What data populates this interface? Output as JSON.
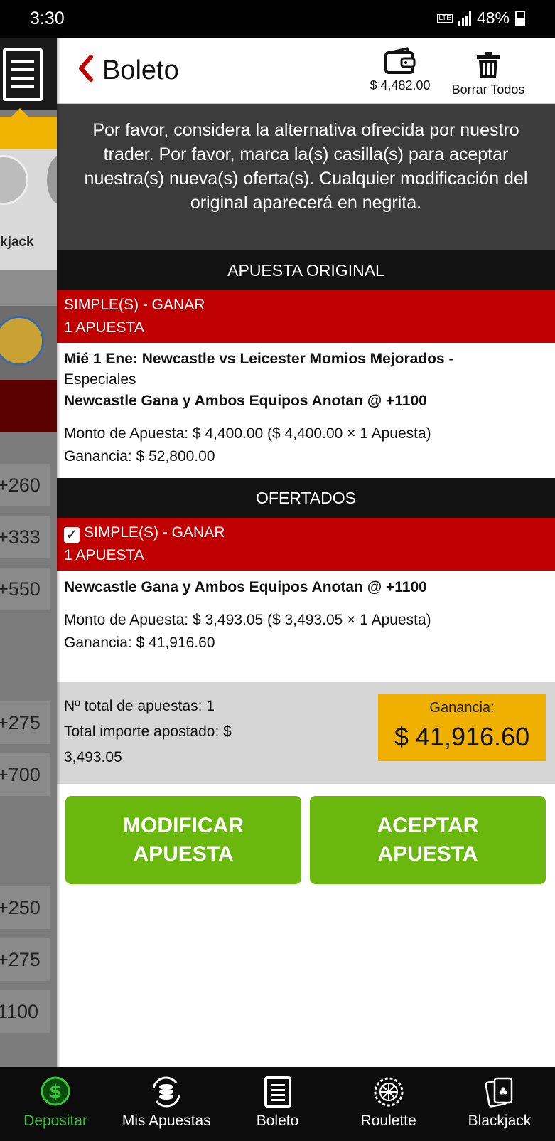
{
  "status_bar": {
    "time": "3:30",
    "battery": "48%",
    "network": "LTE"
  },
  "background_app": {
    "game_label": "kjack",
    "odds": [
      "+260",
      "+333",
      "+550",
      "+275",
      "+700",
      "+250",
      "+275",
      "1100"
    ]
  },
  "header": {
    "title": "Boleto",
    "balance": "$ 4,482.00",
    "clear_all_label": "Borrar Todos"
  },
  "notice": "Por favor, considera la alternativa ofrecida por nuestro trader. Por favor, marca la(s) casilla(s) para aceptar nuestra(s) nueva(s) oferta(s). Cualquier modificación del original aparecerá en negrita.",
  "original": {
    "section_title": "APUESTA ORIGINAL",
    "bet_type": "SIMPLE(S) - GANAR",
    "bet_count": "1 APUESTA",
    "event": "Mié 1 Ene: Newcastle vs Leicester Momios Mejorados -",
    "market": "Especiales",
    "selection": "Newcastle Gana y Ambos Equipos Anotan @ +1100",
    "stake": "Monto de Apuesta: $ 4,400.00 ($ 4,400.00 × 1 Apuesta)",
    "payout": "Ganancia: $ 52,800.00"
  },
  "offered": {
    "section_title": "OFERTADOS",
    "checked": true,
    "bet_type": "SIMPLE(S) - GANAR",
    "bet_count": "1 APUESTA",
    "selection": "Newcastle Gana y Ambos Equipos Anotan @ +1100",
    "stake": "Monto de Apuesta: $ 3,493.05 ($ 3,493.05 × 1 Apuesta)",
    "payout": "Ganancia: $ 41,916.60"
  },
  "summary": {
    "total_bets": "Nº total de apuestas: 1",
    "total_staked_a": "Total importe apostado: $",
    "total_staked_b": "3,493.05",
    "gain_label": "Ganancia:",
    "gain_value": "$ 41,916.60"
  },
  "buttons": {
    "modify_line1": "MODIFICAR",
    "modify_line2": "APUESTA",
    "accept_line1": "ACEPTAR",
    "accept_line2": "APUESTA"
  },
  "bottom_nav": {
    "deposit": "Depositar",
    "my_bets": "Mis Apuestas",
    "betslip": "Boleto",
    "roulette": "Roulette",
    "blackjack": "Blackjack"
  },
  "colors": {
    "accent_red": "#c00000",
    "accept_green": "#6ab80e",
    "gain_yellow": "#f0b000",
    "active_nav_green": "#3ac23a"
  }
}
